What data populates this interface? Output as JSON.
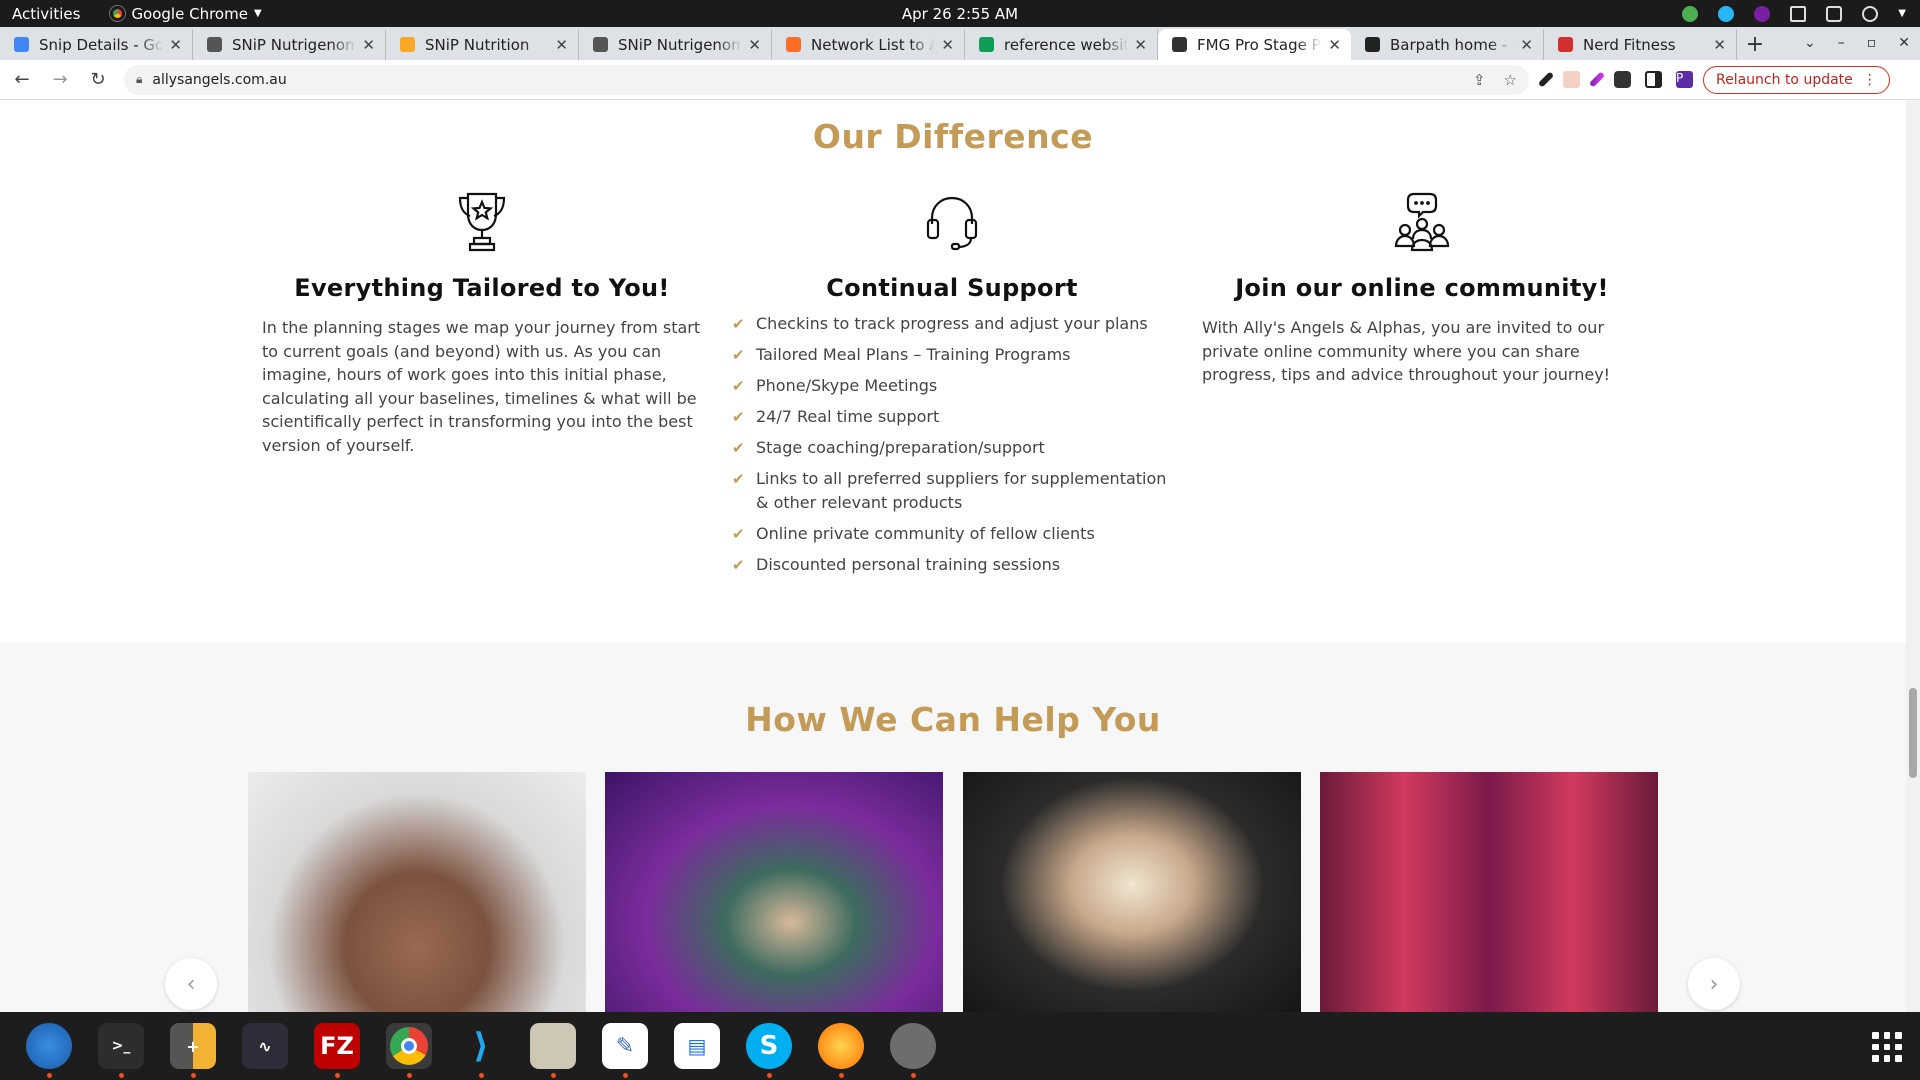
{
  "system": {
    "activities": "Activities",
    "app_name": "Google Chrome",
    "clock": "Apr 26  2:55 AM"
  },
  "tabs": [
    {
      "title": "Snip Details - Google",
      "color": "#4285f4"
    },
    {
      "title": "SNiP Nutrigenomics",
      "color": "#555555"
    },
    {
      "title": "SNiP Nutrition",
      "color": "#f9a825"
    },
    {
      "title": "SNiP Nutrigenomics",
      "color": "#555555"
    },
    {
      "title": "Network List to Ac",
      "color": "#fc6d26"
    },
    {
      "title": "reference website",
      "color": "#0f9d58"
    },
    {
      "title": "FMG Pro Stage Po",
      "color": "#333333"
    },
    {
      "title": "Barpath home - Ba",
      "color": "#222222"
    },
    {
      "title": "Nerd Fitness",
      "color": "#d32f2f"
    }
  ],
  "active_tab_index": 6,
  "toolbar": {
    "url": "allysangels.com.au",
    "relaunch_label": "Relaunch to update",
    "profile_initial": "P"
  },
  "difference": {
    "heading": "Our Difference",
    "col1": {
      "icon": "trophy-icon",
      "title": "Everything Tailored to You!",
      "body": "In the planning stages we map your journey from start to current goals (and beyond) with us. As you can imagine, hours of work goes into this initial phase, calculating all your baselines, timelines & what will be scientifically perfect in transforming you into the best version of yourself."
    },
    "col2": {
      "icon": "headset-icon",
      "title": "Continual Support",
      "items": [
        "Checkins to track progress and adjust your plans",
        "Tailored Meal Plans – Training Programs",
        "Phone/Skype Meetings",
        "24/7 Real time support",
        "Stage coaching/preparation/support",
        "Links to all preferred suppliers for supplementation & other relevant products",
        "Online private community of fellow clients",
        "Discounted personal training sessions"
      ]
    },
    "col3": {
      "icon": "community-icon",
      "title": "Join our online community!",
      "body": "With Ally's Angels & Alphas, you are invited to our private online community where you can share progress, tips and advice throughout your journey!"
    }
  },
  "help": {
    "heading": "How We Can Help You",
    "cards": [
      "male-physique-photo",
      "competition-winner-photo",
      "female-portrait-photo",
      "stage-costume-photo"
    ]
  },
  "colors": {
    "accent": "#c49a57",
    "text": "#444444"
  }
}
